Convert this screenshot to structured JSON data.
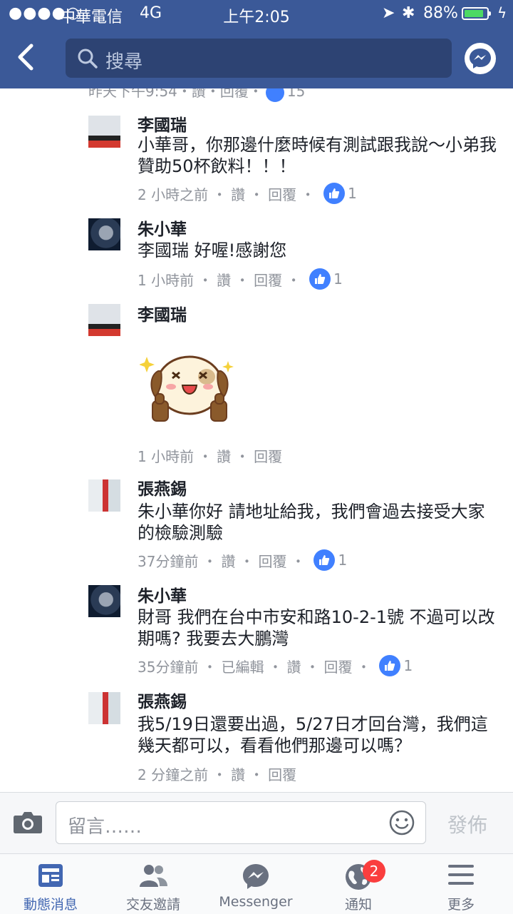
{
  "status_bar": {
    "signal": "●●●●○",
    "carrier": "中華電信",
    "network": "4G",
    "time": "上午2:05",
    "battery": "88%",
    "battery_level": 0.88
  },
  "nav": {
    "search_placeholder": "搜尋"
  },
  "cut_off_line": {
    "text": "昨天下午9:54・讚・回覆・",
    "like_count": "15"
  },
  "comments": [
    {
      "name": "李國瑞",
      "text": "小華哥，你那邊什麼時候有測試跟我說～小弟我贊助50杯飲料！！！",
      "time": "2 小時之前",
      "like": "讚",
      "reply": "回覆",
      "like_count": "1"
    },
    {
      "name": "朱小華",
      "text": "李國瑞 好喔!感謝您",
      "time": "1 小時前",
      "like": "讚",
      "reply": "回覆",
      "like_count": "1"
    },
    {
      "name": "李國瑞",
      "sticker": "thumbs-up-puppy-sticker",
      "time": "1 小時前",
      "like": "讚",
      "reply": "回覆"
    },
    {
      "name": "張燕錫",
      "text": "朱小華你好 請地址給我，我們會過去接受大家的檢驗測驗",
      "time": "37分鐘前",
      "like": "讚",
      "reply": "回覆",
      "like_count": "1"
    },
    {
      "name": "朱小華",
      "text": "財哥 我們在台中市安和路10-2-1號 不過可以改期嗎? 我要去大鵬灣",
      "time": "35分鐘前",
      "edited": "已編輯",
      "like": "讚",
      "reply": "回覆",
      "like_count": "1"
    },
    {
      "name": "張燕錫",
      "text": "我5/19日還要出過，5/27日才回台灣，我們這幾天都可以，看看他們那邊可以嗎？",
      "time": "2 分鐘之前",
      "like": "讚",
      "reply": "回覆"
    }
  ],
  "composer": {
    "placeholder": "留言……",
    "post_label": "發佈"
  },
  "tabs": [
    {
      "label": "動態消息",
      "active": true
    },
    {
      "label": "交友邀請"
    },
    {
      "label": "Messenger"
    },
    {
      "label": "通知",
      "badge": "2"
    },
    {
      "label": "更多"
    }
  ],
  "colors": {
    "brand": "#3b5998",
    "like": "#4080ff",
    "meta": "#90949c",
    "badge": "#fa3e3e"
  }
}
